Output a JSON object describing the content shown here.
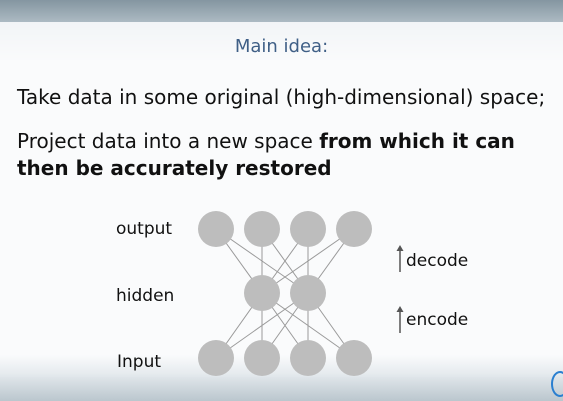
{
  "slide": {
    "title": "Main idea:",
    "line1": "Take data in some original (high-dimensional) space;",
    "line2_normal": "Project data into a new space ",
    "line2_bold": "from which it can then be accurately restored"
  },
  "diagram": {
    "labels": {
      "output": "output",
      "hidden": "hidden",
      "input": "Input",
      "decode": "decode",
      "encode": "encode"
    },
    "layers": {
      "output_nodes": 4,
      "hidden_nodes": 2,
      "input_nodes": 4
    },
    "colors": {
      "node": "#bdbdbd",
      "edge": "#9a9a9a",
      "title": "#3f5f86"
    }
  }
}
